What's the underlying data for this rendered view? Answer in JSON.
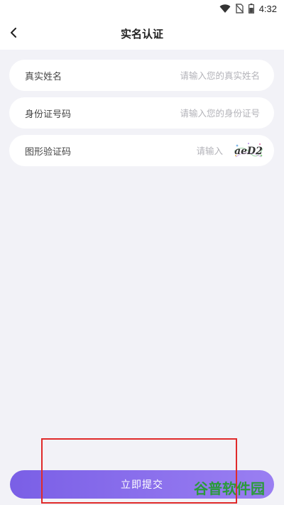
{
  "status_bar": {
    "time": "4:32"
  },
  "nav": {
    "title": "实名认证"
  },
  "form": {
    "name": {
      "label": "真实姓名",
      "placeholder": "请输入您的真实姓名"
    },
    "id_number": {
      "label": "身份证号码",
      "placeholder": "请输入您的身份证号"
    },
    "captcha": {
      "label": "图形验证码",
      "placeholder": "请输入",
      "image_text": "aeD2"
    }
  },
  "submit": {
    "label": "立即提交"
  },
  "watermark": {
    "text": "谷普软件园"
  },
  "colors": {
    "accent": "#7a5fe6",
    "highlight": "#e02a2a",
    "background": "#f2f2f7"
  }
}
